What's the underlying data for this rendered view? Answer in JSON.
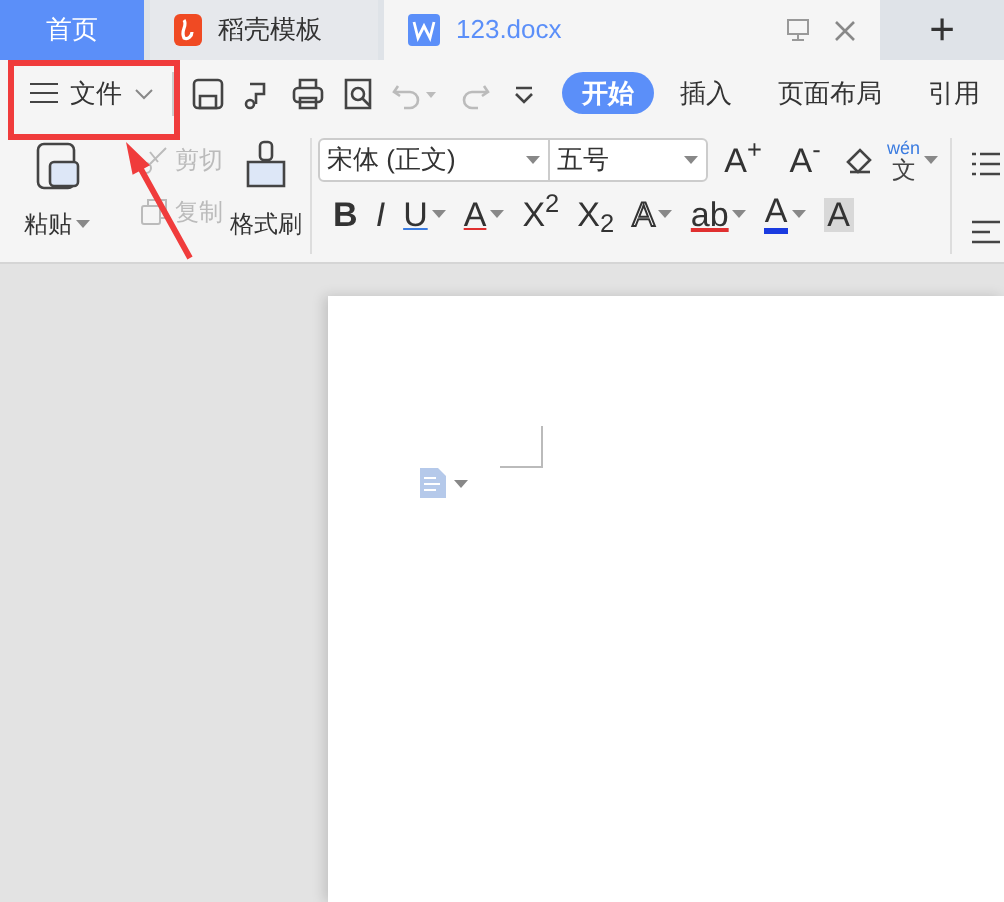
{
  "tabs": [
    {
      "kind": "home",
      "label": "首页",
      "selected": false
    },
    {
      "kind": "template",
      "label": "稻壳模板",
      "selected": false
    },
    {
      "kind": "document",
      "label": "123.docx",
      "selected": true
    }
  ],
  "new_tab": "+",
  "toolbar": {
    "file_menu": "文件",
    "ribbon_tabs": [
      {
        "label": "开始",
        "selected": true
      },
      {
        "label": "插入",
        "selected": false
      },
      {
        "label": "页面布局",
        "selected": false
      },
      {
        "label": "引用",
        "selected": false
      }
    ]
  },
  "ribbon": {
    "paste": "粘贴",
    "cut": {
      "label": "剪切",
      "disabled": true
    },
    "copy": {
      "label": "复制",
      "disabled": true
    },
    "format_painter": "格式刷",
    "font_name": "宋体 (正文)",
    "font_size": "五号",
    "font_buttons": [
      {
        "kind": "grow",
        "label": "A$^{+}$"
      },
      {
        "kind": "shrink",
        "label": "A$^{-}$"
      },
      {
        "kind": "eraser"
      },
      {
        "kind": "pinyin",
        "label": "wén",
        "sub": "文"
      }
    ],
    "format_buttons": [
      {
        "kind": "bold",
        "label": "B",
        "caret": false
      },
      {
        "kind": "italic",
        "label": "I",
        "caret": false
      },
      {
        "kind": "underline",
        "label": "U",
        "caret": true
      },
      {
        "kind": "strike",
        "label": "A",
        "caret": true
      },
      {
        "kind": "plain",
        "label": "X$^{2}$",
        "caret": false
      },
      {
        "kind": "plain",
        "label": "X$_{2}$",
        "caret": false
      },
      {
        "kind": "outline",
        "label": "A",
        "caret": true
      },
      {
        "kind": "highlight",
        "label": "ab",
        "caret": true
      },
      {
        "kind": "color",
        "label": "A",
        "caret": true
      },
      {
        "kind": "shaded",
        "label": "A",
        "caret": false
      }
    ]
  }
}
